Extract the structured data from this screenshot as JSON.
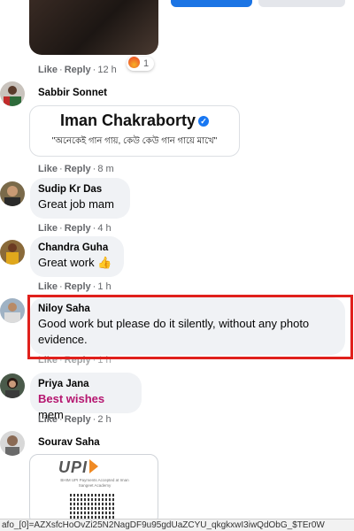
{
  "top": {
    "reaction_count": "1"
  },
  "comments": [
    {
      "actions": {
        "like": "Like",
        "reply": "Reply",
        "time": "12 h"
      }
    },
    {
      "author": "Sabbir Sonnet",
      "card": {
        "name": "Iman Chakraborty",
        "quote": "\"অনেকেই গান গায়, কেউ কেউ গান গায়ে মাখে\""
      },
      "actions": {
        "like": "Like",
        "reply": "Reply",
        "time": "8 m"
      }
    },
    {
      "author": "Sudip Kr Das",
      "text": "Great job mam",
      "actions": {
        "like": "Like",
        "reply": "Reply",
        "time": "4 h"
      }
    },
    {
      "author": "Chandra Guha",
      "text": "Great work",
      "emoji": "👍",
      "actions": {
        "like": "Like",
        "reply": "Reply",
        "time": "1 h"
      }
    },
    {
      "author": "Niloy Saha",
      "text": "Good work but please do it silently, without any photo evidence.",
      "actions": {
        "like": "Like",
        "reply": "Reply",
        "time": "1 h"
      }
    },
    {
      "author": "Priya Jana",
      "text_highlight": "Best wishes",
      "text_rest": " mem",
      "actions": {
        "like": "Like",
        "reply": "Reply",
        "time": "2 h"
      }
    },
    {
      "author": "Sourav Saha",
      "attachment": {
        "logo": "UPI",
        "caption": "BHIM UPI Payments Accepted at Iman Sangeet Academy"
      }
    }
  ],
  "status_bar": {
    "url": "afo_[0]=AZXsfcHoOvZi25N2NagDF9u95gdUaZCYU_qkgkxwI3iwQdObG_$TEr0W"
  },
  "colors": {
    "accent": "#1b74e4",
    "highlight_border": "#e0201c",
    "bubble": "#f0f2f5",
    "best_wishes": "#b5156f"
  }
}
